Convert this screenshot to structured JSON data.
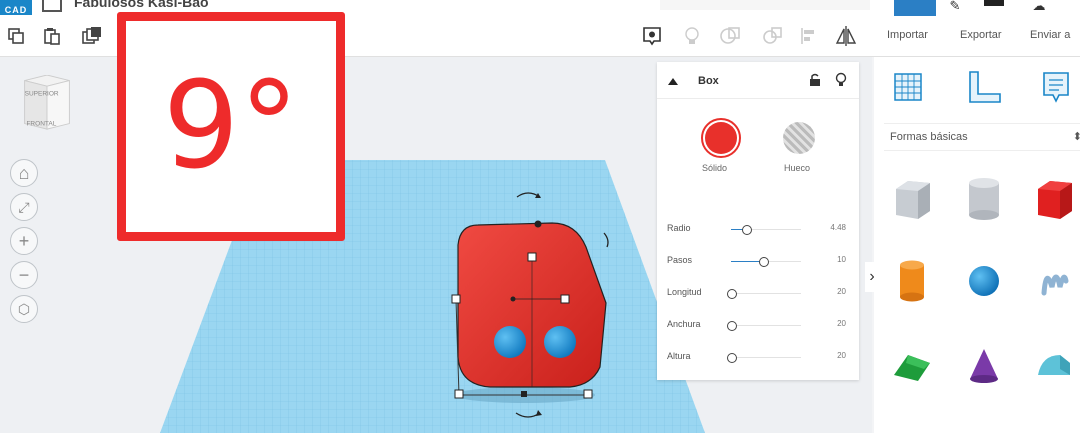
{
  "app": {
    "logo_text": "CAD",
    "title": "Fabulosos Kasi-Bao"
  },
  "toolbar": {
    "import_label": "Importar",
    "export_label": "Exportar",
    "send_label": "Enviar a"
  },
  "viewcube": {
    "top_label": "SUPERIOR",
    "front_label": "FRONTAL"
  },
  "overlay": {
    "text": "9°"
  },
  "panel": {
    "title": "Box",
    "solid_label": "Sólido",
    "hole_label": "Hueco",
    "solid_color": "#e8302b",
    "params": [
      {
        "label": "Radio",
        "value": "4.48",
        "fraction": 0.22
      },
      {
        "label": "Pasos",
        "value": "10",
        "fraction": 0.45
      },
      {
        "label": "Longitud",
        "value": "20",
        "fraction": 0.0
      },
      {
        "label": "Anchura",
        "value": "20",
        "fraction": 0.0
      },
      {
        "label": "Altura",
        "value": "20",
        "fraction": 0.0
      }
    ]
  },
  "library": {
    "category": "Formas básicas"
  },
  "colors": {
    "accent": "#2b7fc5",
    "overlay_red": "#ee2b2b",
    "grid_blue": "#8fd0ee",
    "box_red": "#e8302b",
    "sphere_blue": "#1a8fd6"
  }
}
